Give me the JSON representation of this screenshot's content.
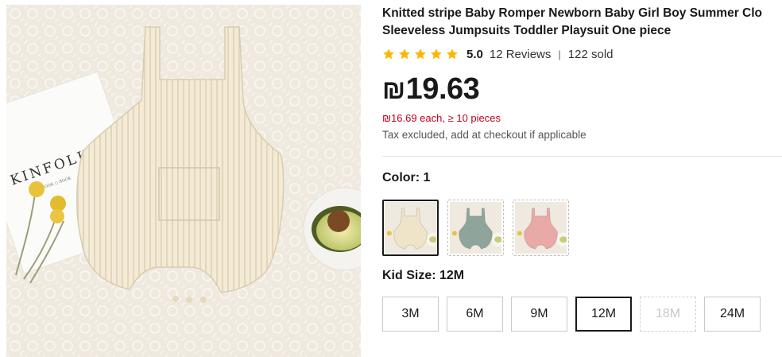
{
  "product": {
    "title_line1": "Knitted stripe Baby Romper Newborn Baby Girl Boy Summer Clo",
    "title_line2": "Sleeveless Jumpsuits Toddler Playsuit One piece",
    "image_text": {
      "brand": "KINFOLK",
      "sub": "BOOK ○ BOOK"
    }
  },
  "rating": {
    "stars": 5,
    "score": "5.0",
    "reviews": "12 Reviews",
    "separator": "|",
    "sold": "122 sold",
    "star_color": "#fdb700"
  },
  "pricing": {
    "currency": "₪",
    "price": "19.63",
    "bulk_note": "₪16.69 each, ≥ 10 pieces",
    "tax_note": "Tax excluded, add at checkout if applicable",
    "bulk_color": "#c3001e"
  },
  "color": {
    "label": "Color: 1",
    "options": [
      {
        "name": "cream",
        "fill": "#efe3c8",
        "selected": true
      },
      {
        "name": "sage",
        "fill": "#8fa59b",
        "selected": false
      },
      {
        "name": "pink",
        "fill": "#e9a9a6",
        "selected": false
      }
    ]
  },
  "size": {
    "label": "Kid Size: 12M",
    "options": [
      {
        "label": "3M",
        "state": "available"
      },
      {
        "label": "6M",
        "state": "available"
      },
      {
        "label": "9M",
        "state": "available"
      },
      {
        "label": "12M",
        "state": "selected"
      },
      {
        "label": "18M",
        "state": "disabled"
      },
      {
        "label": "24M",
        "state": "available"
      }
    ]
  }
}
